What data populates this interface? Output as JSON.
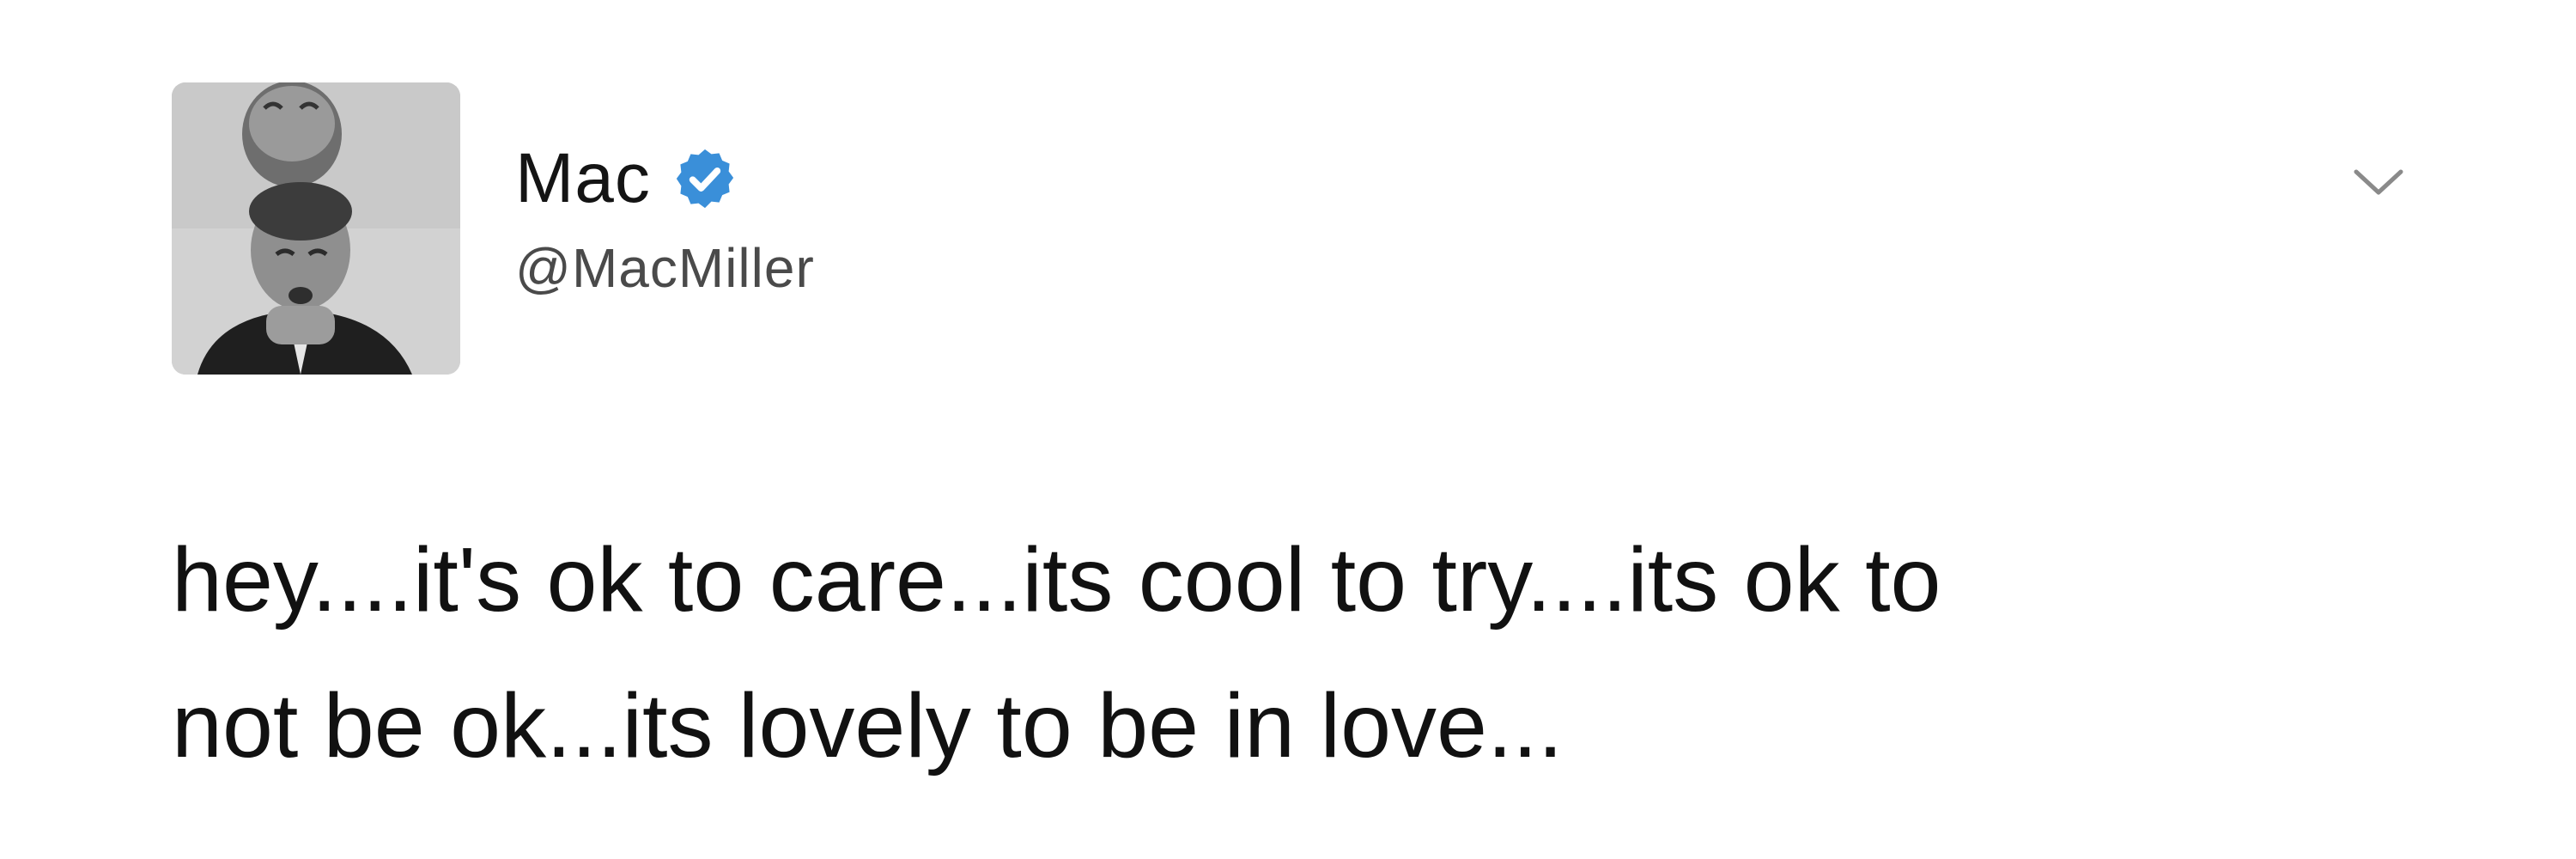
{
  "tweet": {
    "author": {
      "display_name": "Mac",
      "handle": "@MacMiller",
      "verified": true,
      "avatar_icon": "profile-photo",
      "verified_icon": "verified-badge-icon",
      "verified_color": "#1da1f2"
    },
    "menu_icon": "chevron-down-icon",
    "text_lines": [
      "hey....it's ok to care...its cool to try....its ok to",
      "not be ok...its lovely to be in love..."
    ]
  }
}
